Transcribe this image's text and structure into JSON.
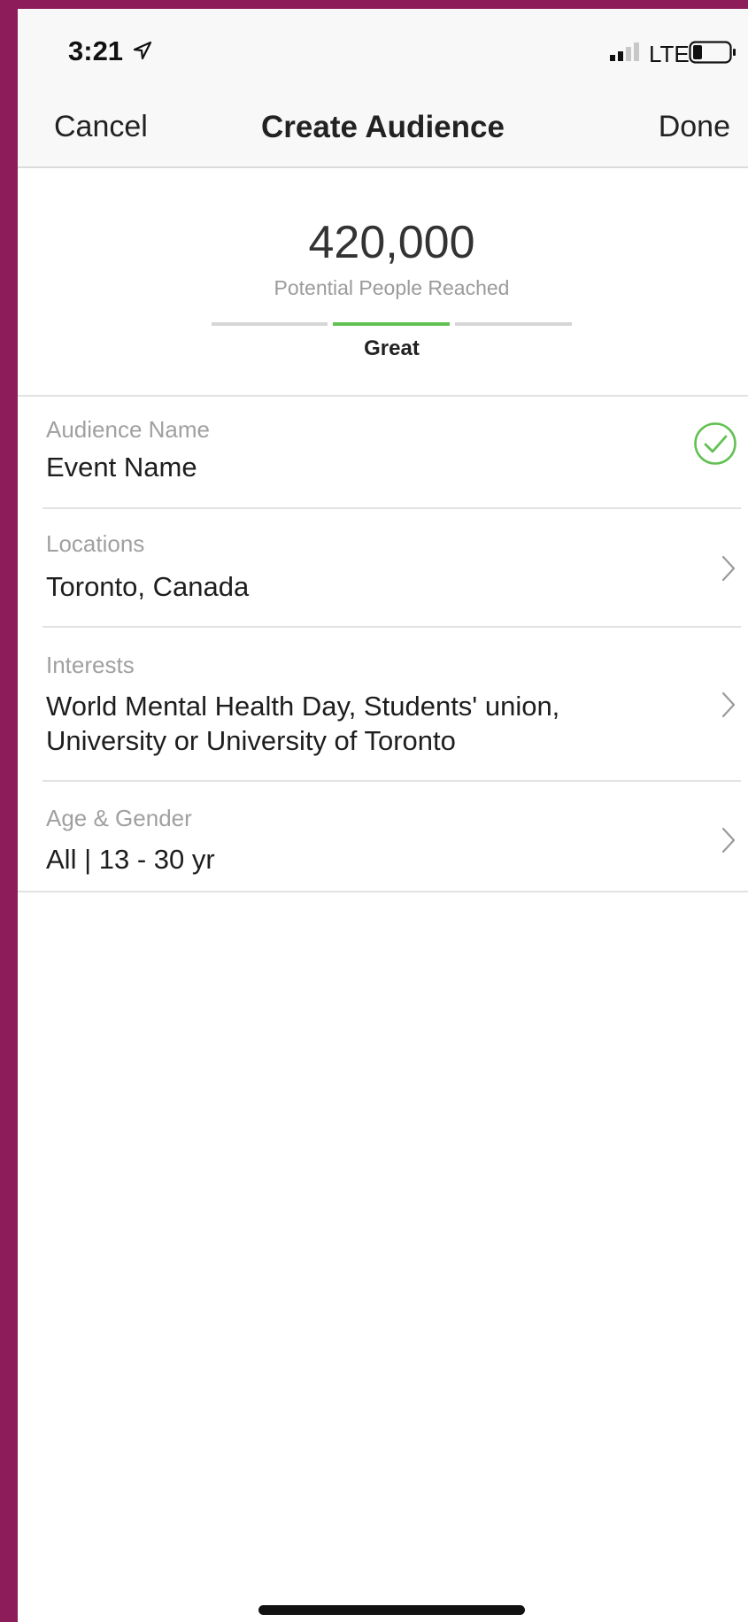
{
  "status_bar": {
    "time": "3:21",
    "network": "LTE",
    "icons": [
      "location-arrow-icon",
      "signal-bars-icon",
      "battery-icon"
    ]
  },
  "nav": {
    "cancel_label": "Cancel",
    "title": "Create Audience",
    "done_label": "Done"
  },
  "reach": {
    "count": "420,000",
    "label": "Potential People Reached",
    "rating": "Great",
    "rating_level": 2,
    "rating_levels_total": 3
  },
  "fields": {
    "audience_name": {
      "label": "Audience Name",
      "value": "Event Name",
      "status_icon": "check-circle-icon"
    },
    "locations": {
      "label": "Locations",
      "value": "Toronto, Canada"
    },
    "interests": {
      "label": "Interests",
      "value_line1": "World Mental Health Day, Students' union,",
      "value_line2": "University or University of Toronto"
    },
    "age_gender": {
      "label": "Age & Gender",
      "value": "All | 13 - 30 yr"
    }
  },
  "colors": {
    "frame": "#8c1c5a",
    "accent_green": "#62c153",
    "meter_gray": "#d6d6d6"
  }
}
